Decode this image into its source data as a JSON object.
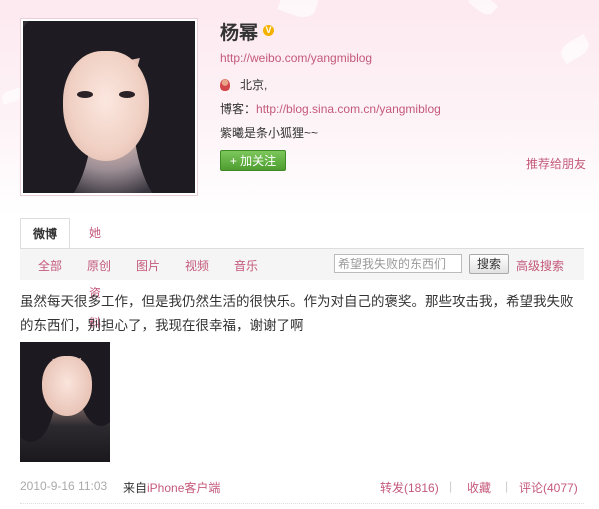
{
  "profile": {
    "name": "杨幂",
    "verified_mark": "V",
    "url": "http://weibo.com/yangmiblog",
    "location": "北京,",
    "blog_label": "博客：",
    "blog_url": "http://blog.sina.com.cn/yangmiblog",
    "intro": "紫曦是条小狐狸~~",
    "follow_label": "+ 加关注",
    "recommend_label": "推荐给朋友"
  },
  "tabs": {
    "active": "微博",
    "other": "她的资料"
  },
  "filters": [
    "全部",
    "原创",
    "图片",
    "视频",
    "音乐"
  ],
  "search": {
    "placeholder": "希望我失败的东西们",
    "button_label": "搜索",
    "advanced_label": "高级搜索"
  },
  "post": {
    "text": "虽然每天很多工作，但是我仍然生活的很快乐。作为对自己的褒奖。那些攻击我，希望我失败的东西们，别担心了，我现在很幸福，谢谢了啊",
    "date": "2010-9-16 11:03",
    "source_prefix": "来自",
    "source_link": "iPhone客户端",
    "repost": "转发(1816)",
    "favorite": "收藏",
    "comment": "评论(4077)",
    "separator": "|"
  },
  "colors": {
    "link": "#c4597b",
    "follow_green": "#4f9d31",
    "header_bg": "#fde9f0"
  }
}
